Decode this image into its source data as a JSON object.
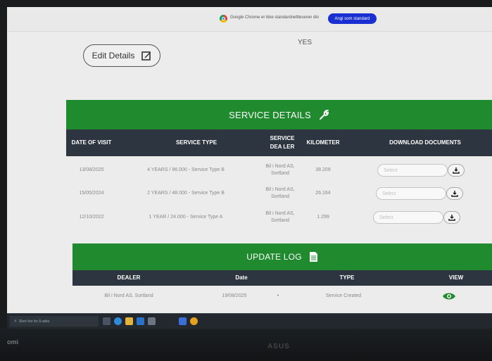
{
  "browser_banner": {
    "message": "Google Chrome er ikke standardnettleseren din",
    "button_label": "Angi som standard"
  },
  "top_value": "YES",
  "edit_button": {
    "label": "Edit Details",
    "icon": "edit-square-icon"
  },
  "service_details": {
    "title": "SERVICE DETAILS",
    "title_icon": "wrench-icon",
    "headers": {
      "date": "DATE OF VISIT",
      "type": "SERVICE TYPE",
      "dealer": "SERVICE DEA LER",
      "km": "KILOMETER",
      "docs": "DOWNLOAD DOCUMENTS"
    },
    "rows": [
      {
        "date": "13/08/2025",
        "type": "4 YEARS / 96.000 - Service Type B",
        "dealer": "Bil i Nord AS, Sortland",
        "km": "38.209",
        "select": "Select"
      },
      {
        "date": "15/05/2024",
        "type": "2 YEARS / 48.000 - Service Type B",
        "dealer": "Bil i Nord AS, Sortland",
        "km": "26.164",
        "select": "Select"
      },
      {
        "date": "12/10/2022",
        "type": "1 YEAR / 24.000 - Service Type A",
        "dealer": "Bil i Nord AS, Sortland",
        "km": "1.299",
        "select": "Select"
      }
    ]
  },
  "update_log": {
    "title": "UPDATE LOG",
    "title_icon": "document-icon",
    "headers": {
      "dealer": "DEALER",
      "date": "Date",
      "type": "TYPE",
      "view": "VIEW"
    },
    "rows": [
      {
        "dealer": "Bil i Nord AS, Sortland",
        "date": "19/08/2025",
        "marker": "•",
        "type": "Service Created"
      }
    ]
  },
  "taskbar": {
    "search_placeholder": "Skriv her for å søke"
  },
  "bezel": {
    "left_text": "omi",
    "logo": "ASUS"
  },
  "colors": {
    "green": "#1f8a2e",
    "header_dark": "#2c3540",
    "eye": "#1f8a2e"
  }
}
